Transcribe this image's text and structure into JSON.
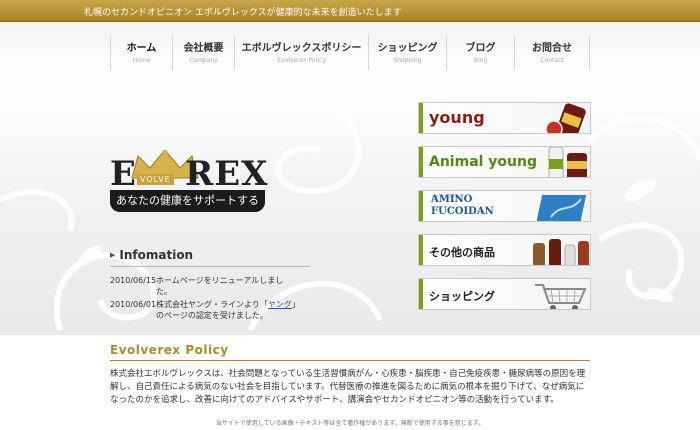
{
  "topbar": {
    "tagline": "札幌のセカンドオピニオン エボルヴレックスが健康的な未来を創造いたします"
  },
  "nav": [
    {
      "jp": "ホーム",
      "en": "Home"
    },
    {
      "jp": "会社概要",
      "en": "Company"
    },
    {
      "jp": "エボルヴレックスポリシー",
      "en": "Evolverex Policy"
    },
    {
      "jp": "ショッピング",
      "en": "Shopping"
    },
    {
      "jp": "ブログ",
      "en": "Blog"
    },
    {
      "jp": "お問合せ",
      "en": "Contact"
    }
  ],
  "logo": {
    "e": "E",
    "volve": "VOLVE",
    "rex": "REX"
  },
  "slogan": "あなたの健康をサポートする",
  "info": {
    "title": "Infomation",
    "news": [
      {
        "date": "2010/06/15",
        "text": "ホームページをリニューアルしました。"
      },
      {
        "date": "2010/06/01",
        "text_before": "株式会社ヤング・ラインより「",
        "link": "ヤング",
        "text_after": "」のページの認定を受けました。"
      }
    ]
  },
  "banners": {
    "young": "young",
    "animal": "Animal young",
    "amino_tiny": "アミノフコイダン",
    "amino_line1": "AMINO",
    "amino_line2": "FUCOIDAN",
    "other": "その他の商品",
    "shop": "ショッピング"
  },
  "policy": {
    "title": "Evolverex Policy",
    "text": "株式会社エボルヴレックスは、社会問題となっている生活習慣病がん・心疾患・脳疾患・自己免疫疾患・糖尿病等の原因を理解し、自己責任による病気のない社会を目指しています。代替医療の推進を図るために病気の根本を掘り下げて、なぜ病気になったのかを追求し、改善に向けてのアドバイスやサポート、講演会やセカンドオピニオン等の活動を行っています。"
  },
  "footer": "当サイトで使用している画像・テキスト等は全て著作権があります。無断で使用する事を禁じます。",
  "colors": {
    "gold": "#b08a2a",
    "topbar": "#b8922f",
    "green": "#7aa016",
    "young_red": "#8c1d10",
    "amino_blue": "#1a5a9c"
  }
}
